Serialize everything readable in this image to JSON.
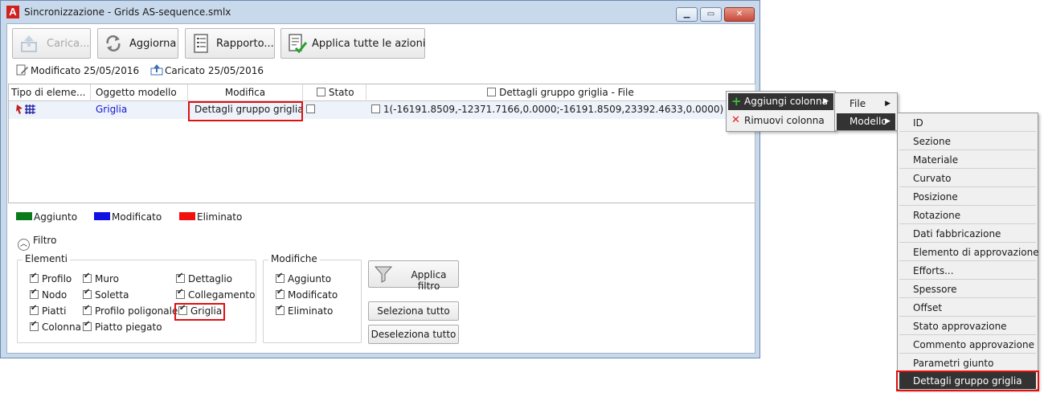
{
  "window": {
    "title": "Sincronizzazione - Grids AS-sequence.smlx",
    "logo": "A"
  },
  "toolbar": {
    "load_label": "Carica...",
    "refresh_label": "Aggiorna",
    "report_label": "Rapporto...",
    "apply_all_label": "Applica tutte le azioni"
  },
  "info": {
    "modified": "Modificato 25/05/2016",
    "loaded": "Caricato 25/05/2016"
  },
  "grid": {
    "headers": {
      "type": "Tipo di eleme...",
      "model_object": "Oggetto modello",
      "change": "Modifica",
      "status": "Stato",
      "details": "Dettagli gruppo griglia - File"
    },
    "row": {
      "model_object": "Griglia",
      "change": "Dettagli gruppo griglia",
      "details": "1(-16191.8509,-12371.7166,0.0000;-16191.8509,23392.4633,0.0000) 2(-7496.03..."
    }
  },
  "legend": {
    "added": "Aggiunto",
    "added_color": "#0a7a1a",
    "modified": "Modificato",
    "modified_color": "#1010e0",
    "deleted": "Eliminato",
    "deleted_color": "#f01010"
  },
  "filter": {
    "toggle_label": "Filtro",
    "elements_title": "Elementi",
    "elements": {
      "profilo": "Profilo",
      "muro": "Muro",
      "dettaglio": "Dettaglio",
      "nodo": "Nodo",
      "soletta": "Soletta",
      "collegamento": "Collegamento",
      "piatti": "Piatti",
      "profilo_poligonale": "Profilo poligonale",
      "griglia": "Griglia",
      "colonna": "Colonna",
      "piatto_piegato": "Piatto piegato"
    },
    "changes_title": "Modifiche",
    "changes": {
      "aggiunto": "Aggiunto",
      "modificato": "Modificato",
      "eliminato": "Eliminato"
    },
    "apply_label": "Applica filtro",
    "select_all_label": "Seleziona tutto",
    "deselect_all_label": "Deseleziona tutto"
  },
  "context_menu": {
    "add_column": "Aggiungi colonna",
    "remove_column": "Rimuovi colonna",
    "file": "File",
    "model": "Modello",
    "model_items": [
      "ID",
      "Sezione",
      "Materiale",
      "Curvato",
      "Posizione",
      "Rotazione",
      "Dati fabbricazione",
      "Elemento di approvazione",
      "Efforts...",
      "Spessore",
      "Offset",
      "Stato approvazione",
      "Commento approvazione",
      "Parametri giunto",
      "Dettagli gruppo griglia"
    ]
  }
}
